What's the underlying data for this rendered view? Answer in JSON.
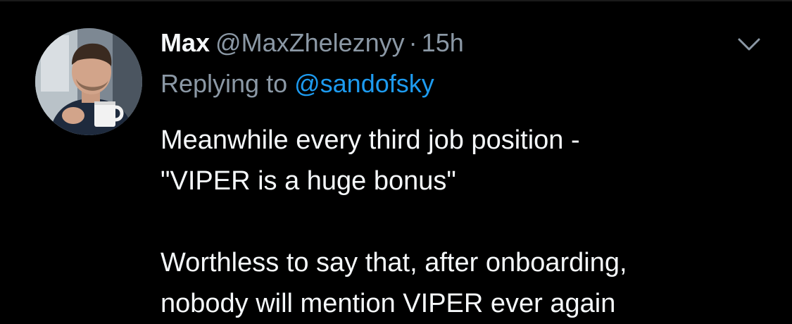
{
  "tweet": {
    "author": {
      "display_name": "Max",
      "handle": "@MaxZheleznyy",
      "avatar": "profile-photo-man-with-mug"
    },
    "separator": "·",
    "timestamp": "15h",
    "reply_prefix": "Replying to ",
    "reply_mention": "@sandofsky",
    "text_lines": [
      "Meanwhile every third job position -",
      "\"VIPER is a huge bonus\"",
      "",
      "Worthless to say that, after onboarding,",
      "nobody will mention VIPER ever again"
    ],
    "menu_icon": "chevron-down-icon"
  },
  "colors": {
    "background": "#000000",
    "primary_text": "#f5f8fa",
    "secondary_text": "#8b98a5",
    "link": "#1d9bf0"
  }
}
